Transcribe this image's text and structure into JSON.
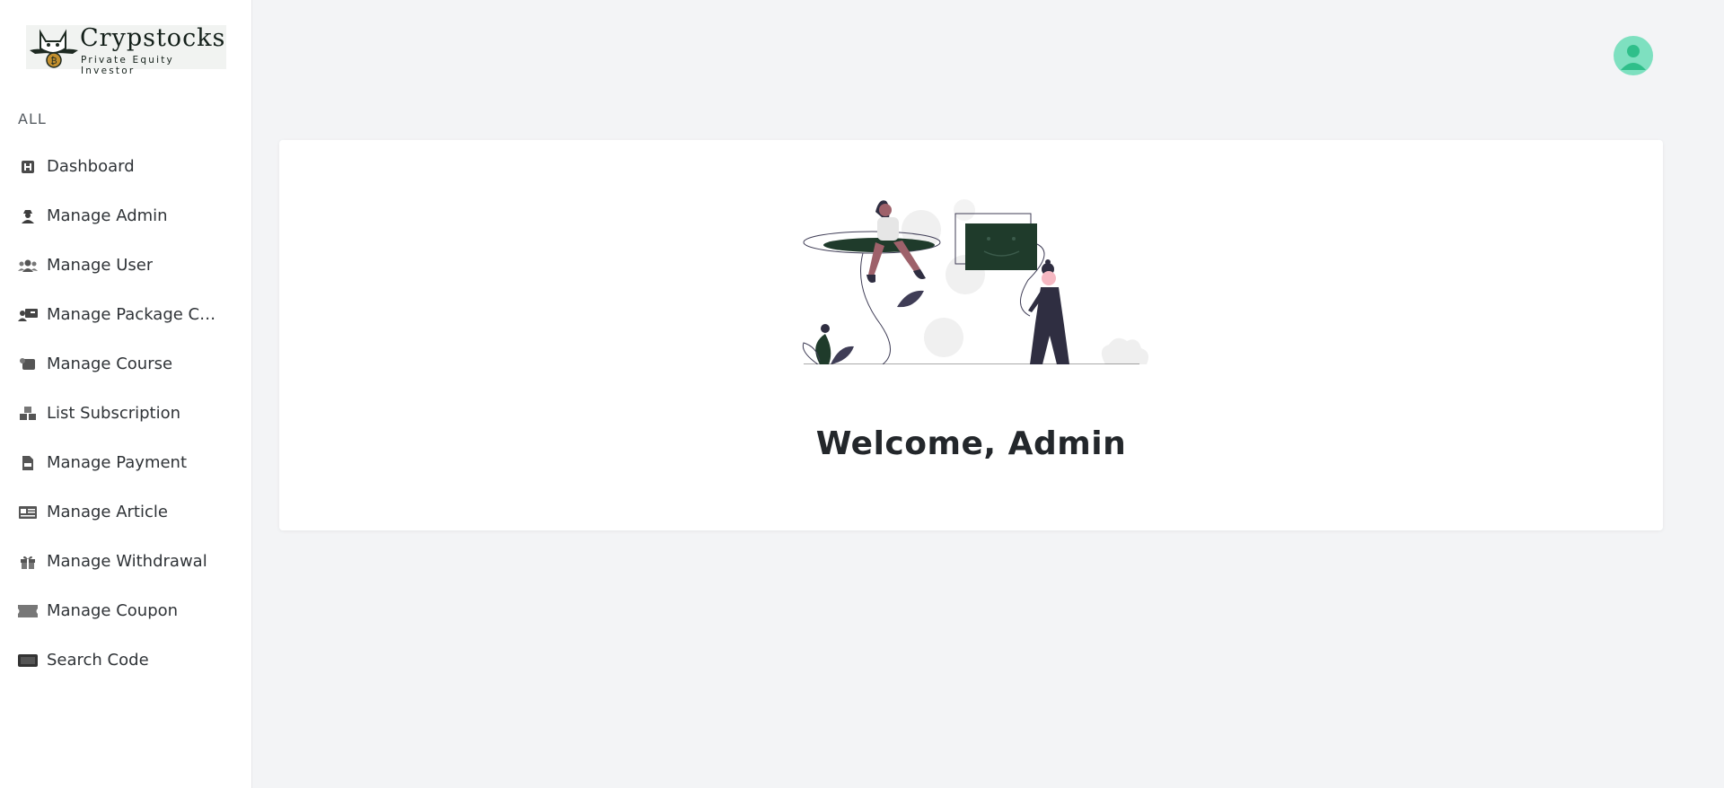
{
  "brand": {
    "name": "Crypstocks",
    "tagline": "Private Equity Investor",
    "accent": "#1f3b2b"
  },
  "sidebar": {
    "section_label": "ALL",
    "items": [
      {
        "label": "Dashboard",
        "icon": "dashboard-icon"
      },
      {
        "label": "Manage Admin",
        "icon": "user-secret-icon"
      },
      {
        "label": "Manage User",
        "icon": "users-icon"
      },
      {
        "label": "Manage Package Co...",
        "icon": "user-card-icon"
      },
      {
        "label": "Manage Course",
        "icon": "scroll-icon"
      },
      {
        "label": "List Subscription",
        "icon": "cubes-icon"
      },
      {
        "label": "Manage Payment",
        "icon": "invoice-icon"
      },
      {
        "label": "Manage Article",
        "icon": "newspaper-icon"
      },
      {
        "label": "Manage Withdrawal",
        "icon": "gift-icon"
      },
      {
        "label": "Manage Coupon",
        "icon": "ticket-icon"
      },
      {
        "label": "Search Code",
        "icon": "barcode-icon"
      }
    ]
  },
  "header": {
    "avatar_icon": "user-avatar-icon",
    "avatar_color": "#7ee0c0"
  },
  "main": {
    "welcome_text": "Welcome, Admin",
    "illustration": "people-illustration"
  }
}
